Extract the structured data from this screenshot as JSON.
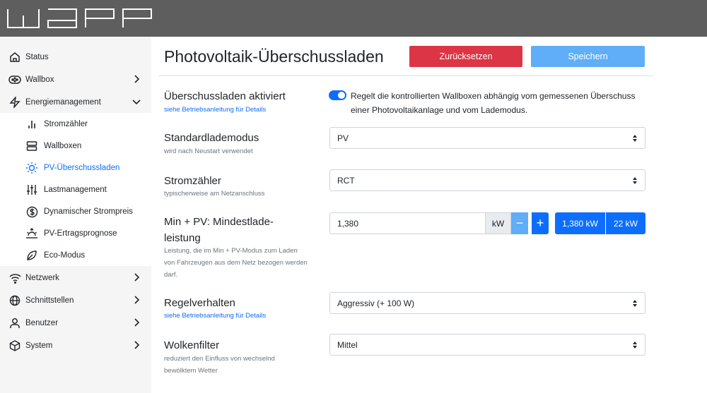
{
  "app": {
    "logo_text": "WARP"
  },
  "sidebar": {
    "items": [
      {
        "label": "Status",
        "icon": "home-icon"
      },
      {
        "label": "Wallbox",
        "icon": "wallbox-icon"
      },
      {
        "label": "Energiemanagement",
        "icon": "bolt-icon"
      },
      {
        "label": "Stromzähler",
        "icon": "meter-bars-icon"
      },
      {
        "label": "Wallboxen",
        "icon": "server-icon"
      },
      {
        "label": "PV-Überschussladen",
        "icon": "sun-icon"
      },
      {
        "label": "Lastmanagement",
        "icon": "sliders-icon"
      },
      {
        "label": "Dynamischer Strompreis",
        "icon": "dollar-icon"
      },
      {
        "label": "PV-Ertragsprognose",
        "icon": "sunrise-icon"
      },
      {
        "label": "Eco-Modus",
        "icon": "feather-icon"
      },
      {
        "label": "Netzwerk",
        "icon": "wifi-icon"
      },
      {
        "label": "Schnittstellen",
        "icon": "globe-icon"
      },
      {
        "label": "Benutzer",
        "icon": "user-icon"
      },
      {
        "label": "System",
        "icon": "box-icon"
      }
    ],
    "active": "PV-Überschussladen"
  },
  "page": {
    "title": "Photovoltaik-Überschussladen",
    "reset_label": "Zurücksetzen",
    "save_label": "Speichern"
  },
  "settings": {
    "excess": {
      "label": "Überschussladen aktiviert",
      "hint": "siehe Betriebsanleitung für Details",
      "enabled": true,
      "description": "Regelt die kontrollierten Wallboxen abhängig vom gemessenen Überschuss einer Photovoltaikanlage und vom Lademodus."
    },
    "default_mode": {
      "label": "Standardlademodus",
      "hint": "wird nach Neustart verwendet",
      "value": "PV"
    },
    "meter": {
      "label": "Stromzähler",
      "hint": "typischerweise am Netzanschluss",
      "value": "RCT"
    },
    "min_power": {
      "label_line1": "Min + PV: Mindestlade-",
      "label_line2": "leistung",
      "hint": "Leistung, die im Min + PV-Modus zum Laden von Fahrzeugen aus dem Netz bezogen werden darf.",
      "value": "1,380",
      "unit": "kW",
      "minus": "−",
      "plus": "+",
      "quick_min": "1,380 kW",
      "quick_max": "22 kW"
    },
    "control": {
      "label": "Regelverhalten",
      "hint": "siehe Betriebsanleitung für Details",
      "value": "Aggressiv (+ 100 W)"
    },
    "cloud_filter": {
      "label": "Wolkenfilter",
      "hint": "reduziert den Einfluss von wechselnd bewölktem Wetter",
      "value": "Mittel"
    }
  },
  "colors": {
    "accent": "#0d6efd",
    "danger": "#dc3545",
    "save_disabled": "#5faef7",
    "topbar": "#5e5e5e"
  }
}
